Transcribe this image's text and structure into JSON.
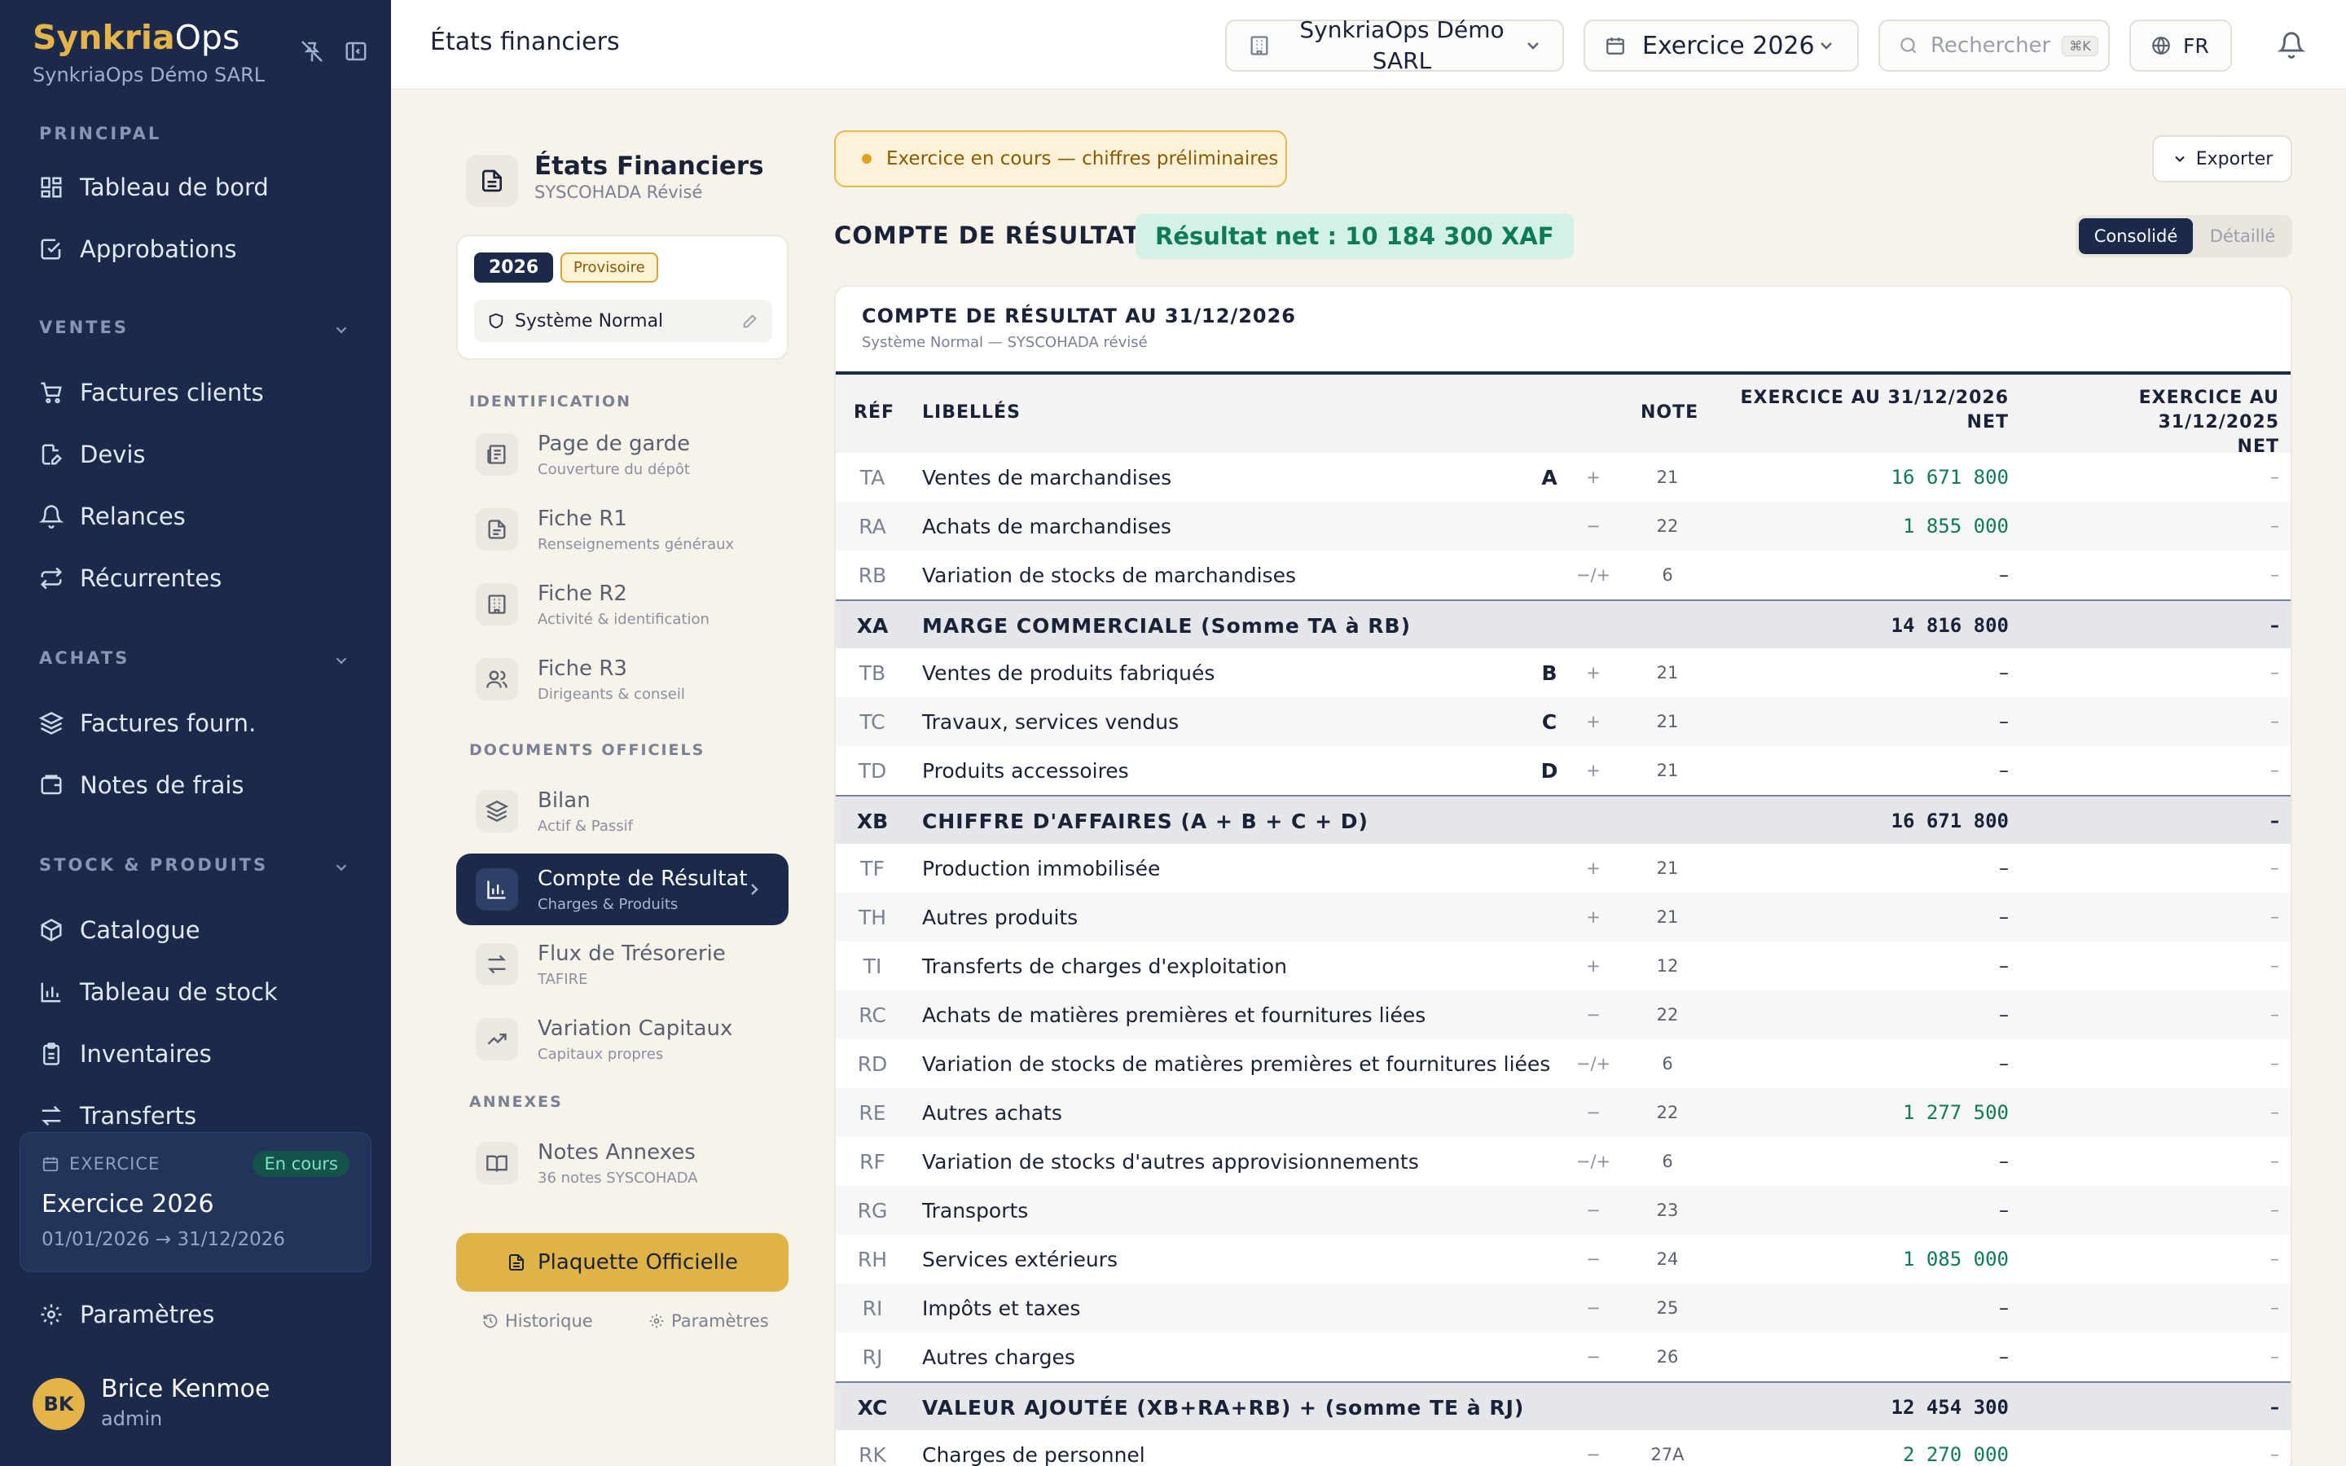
{
  "sidebar": {
    "brand_part1": "Synkria",
    "brand_part2": "Ops",
    "company": "SynkriaOps Démo SARL",
    "sections": {
      "principal": "PRINCIPAL",
      "ventes": "VENTES",
      "achats": "ACHATS",
      "stock": "STOCK & PRODUITS"
    },
    "items": {
      "dashboard": "Tableau de bord",
      "approvals": "Approbations",
      "invoices": "Factures clients",
      "quotes": "Devis",
      "reminders": "Relances",
      "recurring": "Récurrentes",
      "supplier_invoices": "Factures fourn.",
      "expenses": "Notes de frais",
      "catalog": "Catalogue",
      "stock_board": "Tableau de stock",
      "inventories": "Inventaires",
      "transfers": "Transferts",
      "settings": "Paramètres"
    },
    "exercice": {
      "label": "EXERCICE",
      "badge": "En cours",
      "title": "Exercice 2026",
      "dates": "01/01/2026 → 31/12/2026"
    },
    "user": {
      "initials": "BK",
      "name": "Brice Kenmoe",
      "role": "admin"
    }
  },
  "topbar": {
    "title": "États financiers",
    "company": "SynkriaOps Démo SARL",
    "fiscal_year": "Exercice 2026",
    "search_placeholder": "Rechercher",
    "search_shortcut": "⌘K",
    "language": "FR"
  },
  "left_panel": {
    "title": "États Financiers",
    "subtitle": "SYSCOHADA Révisé",
    "year": "2026",
    "status": "Provisoire",
    "system": "Système Normal",
    "sections": {
      "identification": "IDENTIFICATION",
      "documents": "DOCUMENTS OFFICIELS",
      "annexes": "ANNEXES"
    },
    "nav": {
      "cover": {
        "label": "Page de garde",
        "sub": "Couverture du dépôt"
      },
      "r1": {
        "label": "Fiche R1",
        "sub": "Renseignements généraux"
      },
      "r2": {
        "label": "Fiche R2",
        "sub": "Activité & identification"
      },
      "r3": {
        "label": "Fiche R3",
        "sub": "Dirigeants & conseil"
      },
      "bilan": {
        "label": "Bilan",
        "sub": "Actif & Passif"
      },
      "resultat": {
        "label": "Compte de Résultat",
        "sub": "Charges & Produits"
      },
      "flux": {
        "label": "Flux de Trésorerie",
        "sub": "TAFIRE"
      },
      "capitaux": {
        "label": "Variation Capitaux",
        "sub": "Capitaux propres"
      },
      "notes": {
        "label": "Notes Annexes",
        "sub": "36 notes SYSCOHADA"
      }
    },
    "plaquette": "Plaquette Officielle",
    "history": "Historique",
    "params": "Paramètres"
  },
  "main": {
    "banner": "Exercice en cours — chiffres préliminaires",
    "export": "Exporter",
    "heading": "COMPTE DE RÉSULTAT",
    "net_result": "Résultat net : 10 184 300 XAF",
    "toggle_on": "Consolidé",
    "toggle_off": "Détaillé",
    "table_title": "COMPTE DE RÉSULTAT AU 31/12/2026",
    "table_sub": "Système Normal — SYSCOHADA révisé",
    "headers": {
      "ref": "RÉF",
      "lib": "LIBELLÉS",
      "note": "NOTE",
      "cur_l1": "EXERCICE AU 31/12/2026",
      "cur_l2": "NET",
      "prev_l1": "EXERCICE AU 31/12/2025",
      "prev_l2": "NET"
    },
    "rows": [
      {
        "ref": "TA",
        "label": "Ventes de marchandises",
        "letter": "A",
        "sign": "+",
        "note": "21",
        "current": "16 671 800",
        "previous": "–",
        "type": "row"
      },
      {
        "ref": "RA",
        "label": "Achats de marchandises",
        "letter": "",
        "sign": "−",
        "note": "22",
        "current": "1 855 000",
        "previous": "–",
        "type": "row"
      },
      {
        "ref": "RB",
        "label": "Variation de stocks de marchandises",
        "letter": "",
        "sign": "−/+",
        "note": "6",
        "current": "–",
        "previous": "–",
        "type": "row"
      },
      {
        "ref": "XA",
        "label": "MARGE COMMERCIALE (Somme TA à RB)",
        "letter": "",
        "sign": "",
        "note": "",
        "current": "14 816 800",
        "previous": "–",
        "type": "sub"
      },
      {
        "ref": "TB",
        "label": "Ventes de produits fabriqués",
        "letter": "B",
        "sign": "+",
        "note": "21",
        "current": "–",
        "previous": "–",
        "type": "row"
      },
      {
        "ref": "TC",
        "label": "Travaux, services vendus",
        "letter": "C",
        "sign": "+",
        "note": "21",
        "current": "–",
        "previous": "–",
        "type": "row"
      },
      {
        "ref": "TD",
        "label": "Produits accessoires",
        "letter": "D",
        "sign": "+",
        "note": "21",
        "current": "–",
        "previous": "–",
        "type": "row"
      },
      {
        "ref": "XB",
        "label": "CHIFFRE D'AFFAIRES (A + B + C + D)",
        "letter": "",
        "sign": "",
        "note": "",
        "current": "16 671 800",
        "previous": "–",
        "type": "sub"
      },
      {
        "ref": "TF",
        "label": "Production immobilisée",
        "letter": "",
        "sign": "+",
        "note": "21",
        "current": "–",
        "previous": "–",
        "type": "row"
      },
      {
        "ref": "TH",
        "label": "Autres produits",
        "letter": "",
        "sign": "+",
        "note": "21",
        "current": "–",
        "previous": "–",
        "type": "row"
      },
      {
        "ref": "TI",
        "label": "Transferts de charges d'exploitation",
        "letter": "",
        "sign": "+",
        "note": "12",
        "current": "–",
        "previous": "–",
        "type": "row"
      },
      {
        "ref": "RC",
        "label": "Achats de matières premières et fournitures liées",
        "letter": "",
        "sign": "−",
        "note": "22",
        "current": "–",
        "previous": "–",
        "type": "row"
      },
      {
        "ref": "RD",
        "label": "Variation de stocks de matières premières et fournitures liées",
        "letter": "",
        "sign": "−/+",
        "note": "6",
        "current": "–",
        "previous": "–",
        "type": "row"
      },
      {
        "ref": "RE",
        "label": "Autres achats",
        "letter": "",
        "sign": "−",
        "note": "22",
        "current": "1 277 500",
        "previous": "–",
        "type": "row"
      },
      {
        "ref": "RF",
        "label": "Variation de stocks d'autres approvisionnements",
        "letter": "",
        "sign": "−/+",
        "note": "6",
        "current": "–",
        "previous": "–",
        "type": "row"
      },
      {
        "ref": "RG",
        "label": "Transports",
        "letter": "",
        "sign": "−",
        "note": "23",
        "current": "–",
        "previous": "–",
        "type": "row"
      },
      {
        "ref": "RH",
        "label": "Services extérieurs",
        "letter": "",
        "sign": "−",
        "note": "24",
        "current": "1 085 000",
        "previous": "–",
        "type": "row"
      },
      {
        "ref": "RI",
        "label": "Impôts et taxes",
        "letter": "",
        "sign": "−",
        "note": "25",
        "current": "–",
        "previous": "–",
        "type": "row"
      },
      {
        "ref": "RJ",
        "label": "Autres charges",
        "letter": "",
        "sign": "−",
        "note": "26",
        "current": "–",
        "previous": "–",
        "type": "row"
      },
      {
        "ref": "XC",
        "label": "VALEUR AJOUTÉE (XB+RA+RB) + (somme TE à RJ)",
        "letter": "",
        "sign": "",
        "note": "",
        "current": "12 454 300",
        "previous": "–",
        "type": "sub"
      },
      {
        "ref": "RK",
        "label": "Charges de personnel",
        "letter": "",
        "sign": "−",
        "note": "27A",
        "current": "2 270 000",
        "previous": "–",
        "type": "row"
      }
    ]
  },
  "colors": {
    "sidebar": "#1b2a4a",
    "accent": "#e0b347",
    "positive": "#0e7a5a",
    "warning": "#e3b955"
  }
}
